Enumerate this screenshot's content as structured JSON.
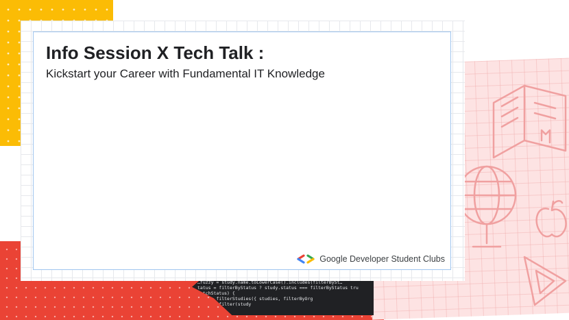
{
  "slide": {
    "title": "Info Session X Tech Talk :",
    "subtitle": "Kickstart your Career with Fundamental IT Knowledge"
  },
  "brand": {
    "name": "Google Developer Student Clubs",
    "logo_icon": "gdsc-brackets-icon",
    "colors": [
      "#ea4335",
      "#4285f4",
      "#34a853",
      "#fbbc05"
    ]
  },
  "background": {
    "colors": {
      "yellow": "#fbbc05",
      "red": "#ea4335",
      "pink": "#fde3e3",
      "code_bg": "#202124"
    },
    "code_lines": [
      "…fuzzy = study.name.toLowerCase().includes(filterBySt…",
      "tatus = filterByStatus ? study.status === filterByStatus   tru",
      "natchStatus) {",
      "",
      "          :ction filterStudies({ studies, filterByOrg",
      "                         studies.filter(study"
    ],
    "doodles": [
      "book-icon",
      "globe-icon",
      "apple-icon",
      "set-square-icon"
    ]
  }
}
